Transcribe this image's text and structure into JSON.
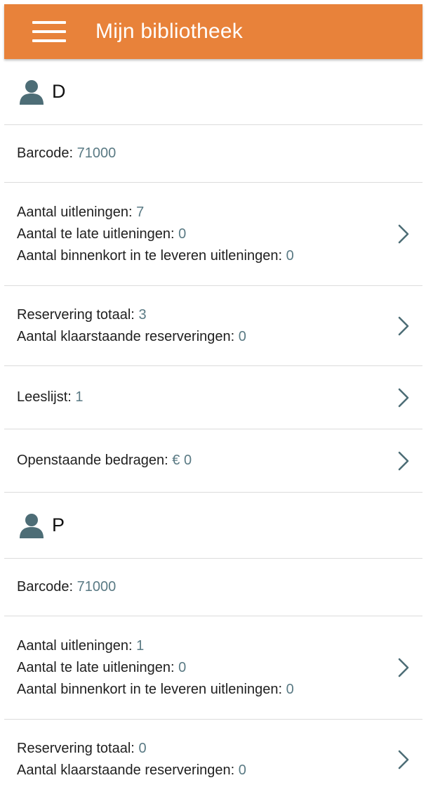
{
  "appbar": {
    "title": "Mijn bibliotheek"
  },
  "accounts": [
    {
      "name": "D",
      "barcode_label": "Barcode:",
      "barcode_value": "71000",
      "loans": {
        "count_label": "Aantal uitleningen:",
        "count_value": "7",
        "late_label": "Aantal te late uitleningen:",
        "late_value": "0",
        "due_soon_label": "Aantal binnenkort in te leveren uitleningen:",
        "due_soon_value": "0"
      },
      "reservations": {
        "total_label": "Reservering totaal:",
        "total_value": "3",
        "ready_label": "Aantal klaarstaande reserveringen:",
        "ready_value": "0"
      },
      "reading_list": {
        "label": "Leeslijst:",
        "value": "1"
      },
      "outstanding": {
        "label": "Openstaande bedragen:",
        "value": "€ 0"
      }
    },
    {
      "name": "P",
      "barcode_label": "Barcode:",
      "barcode_value": "71000",
      "loans": {
        "count_label": "Aantal uitleningen:",
        "count_value": "1",
        "late_label": "Aantal te late uitleningen:",
        "late_value": "0",
        "due_soon_label": "Aantal binnenkort in te leveren uitleningen:",
        "due_soon_value": "0"
      },
      "reservations": {
        "total_label": "Reservering totaal:",
        "total_value": "0",
        "ready_label": "Aantal klaarstaande reserveringen:",
        "ready_value": "0"
      }
    }
  ],
  "colors": {
    "appbar": "#e8823a",
    "value_text": "#5a7a84",
    "icon": "#4d6d76",
    "divider": "#dcdcdc"
  },
  "icons": {
    "menu": "hamburger-menu-icon",
    "user": "person-icon",
    "chevron": "chevron-right-icon"
  }
}
